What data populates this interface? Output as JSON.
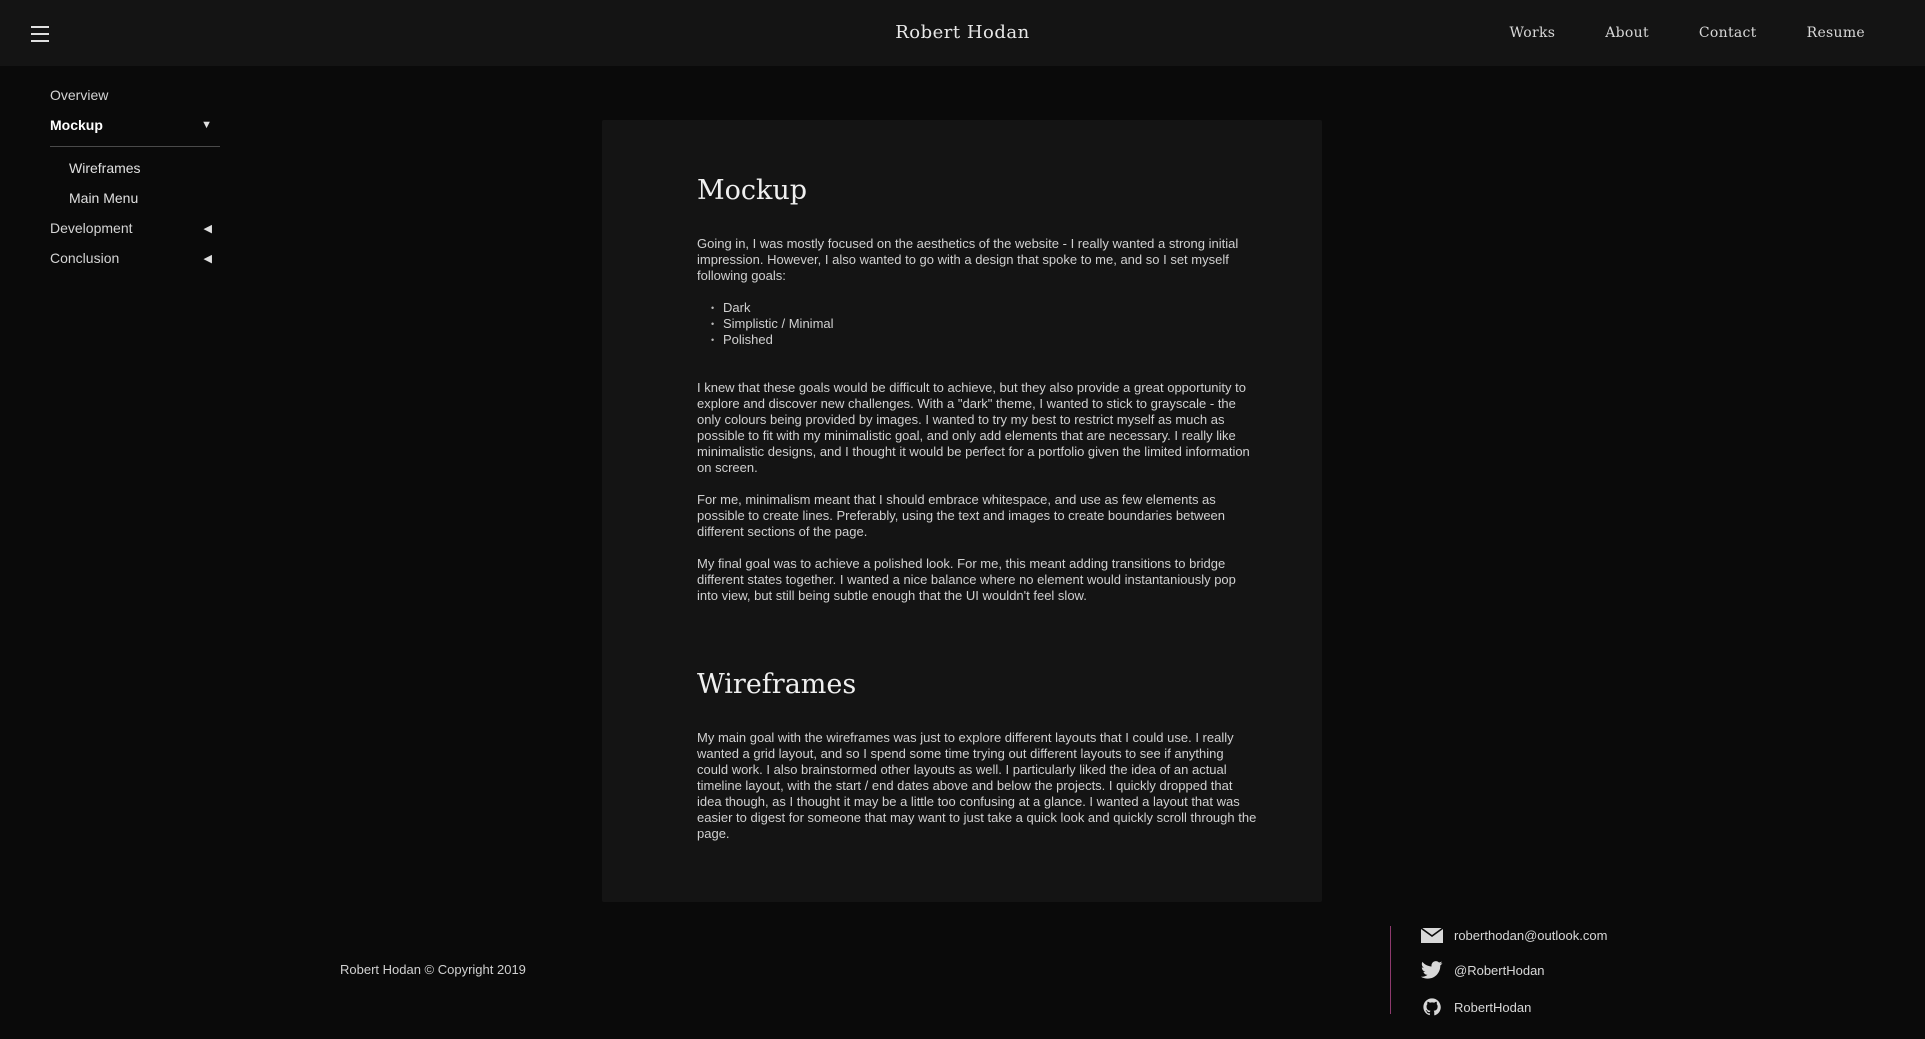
{
  "header": {
    "title": "Robert Hodan",
    "nav": [
      "Works",
      "About",
      "Contact",
      "Resume"
    ]
  },
  "sidebar": {
    "items": [
      {
        "label": "Overview"
      },
      {
        "label": "Mockup",
        "arrow": "▼"
      },
      {
        "label": "Wireframes"
      },
      {
        "label": "Main Menu"
      },
      {
        "label": "Development",
        "arrow": "◀"
      },
      {
        "label": "Conclusion",
        "arrow": "◀"
      }
    ]
  },
  "main": {
    "section1": {
      "heading": "Mockup",
      "intro": "Going in, I was mostly focused on the aesthetics of the website - I really wanted a strong initial impression. However, I also wanted to go with a design that spoke to me, and so I set myself following goals:",
      "goals": [
        "Dark",
        "Simplistic / Minimal",
        "Polished"
      ],
      "p2": "I knew that these goals would be difficult to achieve, but they also provide a great opportunity to explore and discover new challenges. With a \"dark\" theme, I wanted to stick to grayscale - the only colours being provided by images. I wanted to try my best to restrict myself as much as possible to fit with my minimalistic goal, and only add elements that are necessary. I really like minimalistic designs, and I thought it would be perfect for a portfolio given the limited information on screen.",
      "p3": "For me, minimalism meant that I should embrace whitespace, and use as few elements as possible to create lines. Preferably, using the text and images to create boundaries between different sections of the page.",
      "p4": "My final goal was to achieve a polished look. For me, this meant adding transitions to bridge different states together. I wanted a nice balance where no element would instantaniously pop into view, but still being subtle enough that the UI wouldn't feel slow."
    },
    "section2": {
      "heading": "Wireframes",
      "p1": "My main goal with the wireframes was just to explore different layouts that I could use. I really wanted a grid layout, and so I spend some time trying out different layouts to see if anything could work. I also brainstormed other layouts as well. I particularly liked the idea of an actual timeline layout, with the start / end dates above and below the projects. I quickly dropped that idea though, as I thought it may be a little too confusing at a glance. I wanted a layout that was easier to digest for someone that may want to just take a quick look and quickly scroll through the page."
    }
  },
  "footer": {
    "copyright": "Robert Hodan © Copyright 2019",
    "accent": "#8e3a6e",
    "contacts": [
      {
        "icon": "mail-icon",
        "label": "roberthodan@outlook.com"
      },
      {
        "icon": "twitter-icon",
        "label": "@RobertHodan"
      },
      {
        "icon": "github-icon",
        "label": "RobertHodan"
      }
    ]
  }
}
